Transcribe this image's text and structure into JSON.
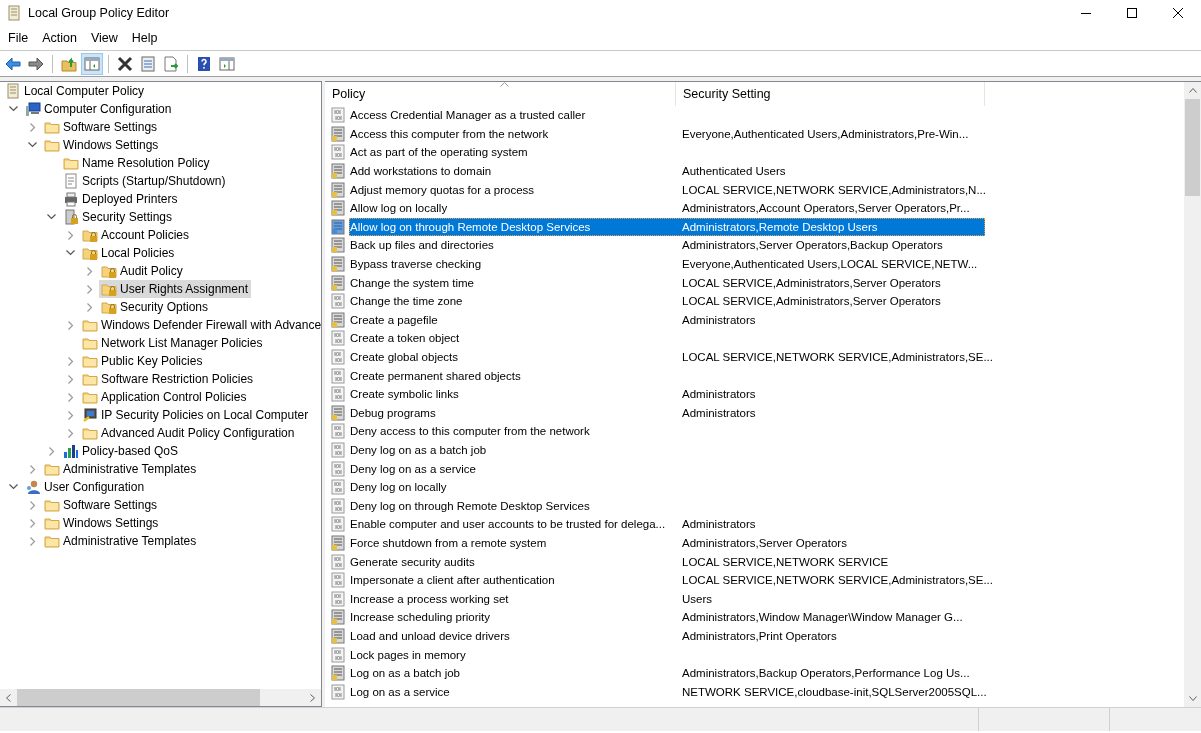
{
  "window": {
    "title": "Local Group Policy Editor"
  },
  "menu": [
    "File",
    "Action",
    "View",
    "Help"
  ],
  "toolbar": [
    {
      "kind": "back",
      "pressed": false
    },
    {
      "kind": "forward",
      "pressed": false
    },
    {
      "kind": "sep"
    },
    {
      "kind": "up",
      "pressed": false
    },
    {
      "kind": "tree",
      "pressed": true
    },
    {
      "kind": "sep"
    },
    {
      "kind": "delete",
      "pressed": false
    },
    {
      "kind": "properties",
      "pressed": false
    },
    {
      "kind": "export",
      "pressed": false
    },
    {
      "kind": "sep"
    },
    {
      "kind": "help",
      "pressed": false
    },
    {
      "kind": "actionpane",
      "pressed": false
    }
  ],
  "tree": [
    {
      "label": "Local Computer Policy",
      "kind": "scroll",
      "selected": false,
      "children": [
        {
          "label": "Computer Configuration",
          "kind": "computer",
          "expanded": true,
          "selected": false,
          "children": [
            {
              "label": "Software Settings",
              "kind": "folder",
              "expanded": false,
              "selected": false
            },
            {
              "label": "Windows Settings",
              "kind": "folder",
              "expanded": true,
              "selected": false,
              "children": [
                {
                  "label": "Name Resolution Policy",
                  "kind": "folder",
                  "selected": false
                },
                {
                  "label": "Scripts (Startup/Shutdown)",
                  "kind": "script",
                  "selected": false
                },
                {
                  "label": "Deployed Printers",
                  "kind": "printer",
                  "selected": false
                },
                {
                  "label": "Security Settings",
                  "kind": "serverlock",
                  "expanded": true,
                  "selected": false,
                  "children": [
                    {
                      "label": "Account Policies",
                      "kind": "lockfolder",
                      "expanded": false,
                      "selected": false
                    },
                    {
                      "label": "Local Policies",
                      "kind": "lockfolder",
                      "expanded": true,
                      "selected": false,
                      "children": [
                        {
                          "label": "Audit Policy",
                          "kind": "lockfolder",
                          "expanded": false,
                          "selected": false
                        },
                        {
                          "label": "User Rights Assignment",
                          "kind": "lockfolder",
                          "expanded": false,
                          "selected": true
                        },
                        {
                          "label": "Security Options",
                          "kind": "lockfolder",
                          "expanded": false,
                          "selected": false
                        }
                      ]
                    },
                    {
                      "label": "Windows Defender Firewall with Advance",
                      "kind": "folder",
                      "expanded": false,
                      "selected": false
                    },
                    {
                      "label": "Network List Manager Policies",
                      "kind": "folder",
                      "selected": false
                    },
                    {
                      "label": "Public Key Policies",
                      "kind": "folder",
                      "expanded": false,
                      "selected": false
                    },
                    {
                      "label": "Software Restriction Policies",
                      "kind": "folder",
                      "expanded": false,
                      "selected": false
                    },
                    {
                      "label": "Application Control Policies",
                      "kind": "folder",
                      "expanded": false,
                      "selected": false
                    },
                    {
                      "label": "IP Security Policies on Local Computer",
                      "kind": "ipcomputer",
                      "expanded": false,
                      "selected": false
                    },
                    {
                      "label": "Advanced Audit Policy Configuration",
                      "kind": "folder",
                      "expanded": false,
                      "selected": false
                    }
                  ]
                },
                {
                  "label": "Policy-based QoS",
                  "kind": "chart",
                  "expanded": false,
                  "selected": false
                }
              ]
            },
            {
              "label": "Administrative Templates",
              "kind": "folder",
              "expanded": false,
              "selected": false
            }
          ]
        },
        {
          "label": "User Configuration",
          "kind": "user",
          "expanded": true,
          "selected": false,
          "children": [
            {
              "label": "Software Settings",
              "kind": "folder",
              "expanded": false,
              "selected": false
            },
            {
              "label": "Windows Settings",
              "kind": "folder",
              "expanded": false,
              "selected": false
            },
            {
              "label": "Administrative Templates",
              "kind": "folder",
              "expanded": false,
              "selected": false
            }
          ]
        }
      ]
    }
  ],
  "columns": [
    {
      "label": "Policy",
      "sorted": true
    },
    {
      "label": "Security Setting",
      "sorted": false
    }
  ],
  "rows": [
    {
      "policy": "Access Credential Manager as a trusted caller",
      "kind": "binary",
      "selected": false
    },
    {
      "policy": "Access this computer from the network",
      "setting": "Everyone,Authenticated Users,Administrators,Pre-Win...",
      "kind": "server",
      "selected": false
    },
    {
      "policy": "Act as part of the operating system",
      "kind": "binary",
      "selected": false
    },
    {
      "policy": "Add workstations to domain",
      "setting": "Authenticated Users",
      "kind": "server",
      "selected": false
    },
    {
      "policy": "Adjust memory quotas for a process",
      "setting": "LOCAL SERVICE,NETWORK SERVICE,Administrators,N...",
      "kind": "server",
      "selected": false
    },
    {
      "policy": "Allow log on locally",
      "setting": "Administrators,Account Operators,Server Operators,Pr...",
      "kind": "server",
      "selected": false
    },
    {
      "policy": "Allow log on through Remote Desktop Services",
      "setting": "Administrators,Remote Desktop Users",
      "kind": "server",
      "selected": true
    },
    {
      "policy": "Back up files and directories",
      "setting": "Administrators,Server Operators,Backup Operators",
      "kind": "server",
      "selected": false
    },
    {
      "policy": "Bypass traverse checking",
      "setting": "Everyone,Authenticated Users,LOCAL SERVICE,NETW...",
      "kind": "server",
      "selected": false
    },
    {
      "policy": "Change the system time",
      "setting": "LOCAL SERVICE,Administrators,Server Operators",
      "kind": "server",
      "selected": false
    },
    {
      "policy": "Change the time zone",
      "setting": "LOCAL SERVICE,Administrators,Server Operators",
      "kind": "binary",
      "selected": false
    },
    {
      "policy": "Create a pagefile",
      "setting": "Administrators",
      "kind": "server",
      "selected": false
    },
    {
      "policy": "Create a token object",
      "kind": "binary",
      "selected": false
    },
    {
      "policy": "Create global objects",
      "setting": "LOCAL SERVICE,NETWORK SERVICE,Administrators,SE...",
      "kind": "binary",
      "selected": false
    },
    {
      "policy": "Create permanent shared objects",
      "kind": "binary",
      "selected": false
    },
    {
      "policy": "Create symbolic links",
      "setting": "Administrators",
      "kind": "binary",
      "selected": false
    },
    {
      "policy": "Debug programs",
      "setting": "Administrators",
      "kind": "server",
      "selected": false
    },
    {
      "policy": "Deny access to this computer from the network",
      "kind": "binary",
      "selected": false
    },
    {
      "policy": "Deny log on as a batch job",
      "kind": "binary",
      "selected": false
    },
    {
      "policy": "Deny log on as a service",
      "kind": "binary",
      "selected": false
    },
    {
      "policy": "Deny log on locally",
      "kind": "binary",
      "selected": false
    },
    {
      "policy": "Deny log on through Remote Desktop Services",
      "kind": "binary",
      "selected": false
    },
    {
      "policy": "Enable computer and user accounts to be trusted for delega...",
      "setting": "Administrators",
      "kind": "binary",
      "selected": false
    },
    {
      "policy": "Force shutdown from a remote system",
      "setting": "Administrators,Server Operators",
      "kind": "server",
      "selected": false
    },
    {
      "policy": "Generate security audits",
      "setting": "LOCAL SERVICE,NETWORK SERVICE",
      "kind": "binary",
      "selected": false
    },
    {
      "policy": "Impersonate a client after authentication",
      "setting": "LOCAL SERVICE,NETWORK SERVICE,Administrators,SE...",
      "kind": "binary",
      "selected": false
    },
    {
      "policy": "Increase a process working set",
      "setting": "Users",
      "kind": "binary",
      "selected": false
    },
    {
      "policy": "Increase scheduling priority",
      "setting": "Administrators,Window Manager\\Window Manager G...",
      "kind": "server",
      "selected": false
    },
    {
      "policy": "Load and unload device drivers",
      "setting": "Administrators,Print Operators",
      "kind": "server",
      "selected": false
    },
    {
      "policy": "Lock pages in memory",
      "kind": "binary",
      "selected": false
    },
    {
      "policy": "Log on as a batch job",
      "setting": "Administrators,Backup Operators,Performance Log Us...",
      "kind": "server",
      "selected": false
    },
    {
      "policy": "Log on as a service",
      "setting": "NETWORK SERVICE,cloudbase-init,SQLServer2005SQL...",
      "kind": "binary",
      "selected": false
    }
  ]
}
